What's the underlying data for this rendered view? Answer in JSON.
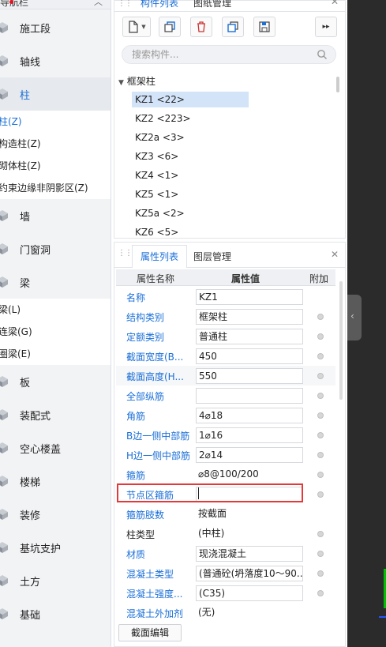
{
  "nav": {
    "header_title": "导航栏",
    "categories_top": [
      {
        "label": "施工段",
        "icon": "construction-segment-icon"
      },
      {
        "label": "轴线",
        "icon": "axis-grid-icon"
      },
      {
        "label": "柱",
        "icon": "column-icon",
        "selected": true
      }
    ],
    "column_subitems": [
      "柱(Z)",
      "构造柱(Z)",
      "砌体柱(Z)",
      "约束边缘非阴影区(Z)"
    ],
    "categories_mid": [
      {
        "label": "墙",
        "icon": "wall-icon"
      },
      {
        "label": "门窗洞",
        "icon": "door-window-icon"
      },
      {
        "label": "梁",
        "icon": "beam-icon"
      }
    ],
    "beam_subitems": [
      "梁(L)",
      "连梁(G)",
      "圈梁(E)"
    ],
    "categories_bottom": [
      {
        "label": "板",
        "icon": "slab-icon"
      },
      {
        "label": "装配式",
        "icon": "prefab-icon"
      },
      {
        "label": "空心楼盖",
        "icon": "hollow-floor-icon"
      },
      {
        "label": "楼梯",
        "icon": "stair-icon"
      },
      {
        "label": "装修",
        "icon": "decoration-icon"
      },
      {
        "label": "基坑支护",
        "icon": "pit-support-icon"
      },
      {
        "label": "土方",
        "icon": "earthwork-icon"
      },
      {
        "label": "基础",
        "icon": "foundation-icon"
      }
    ]
  },
  "component_panel": {
    "tab_list": "构件列表",
    "tab_drawing": "图纸管理",
    "search_placeholder": "搜索构件...",
    "tree_root": "框架柱",
    "items": [
      "KZ1 <22>",
      "KZ2 <223>",
      "KZ2a <3>",
      "KZ3 <6>",
      "KZ4 <1>",
      "KZ5 <1>",
      "KZ5a <2>",
      "KZ6 <5>"
    ]
  },
  "property_panel": {
    "tab_props": "属性列表",
    "tab_layers": "图层管理",
    "col_name": "属性名称",
    "col_value": "属性值",
    "col_extra": "附加",
    "rows": [
      {
        "name": "名称",
        "value": "KZ1",
        "blue": true,
        "boxed": true,
        "check": false
      },
      {
        "name": "结构类别",
        "value": "框架柱",
        "blue": true,
        "boxed": true,
        "check": true
      },
      {
        "name": "定额类别",
        "value": "普通柱",
        "blue": true,
        "boxed": true,
        "check": true
      },
      {
        "name": "截面宽度(B...",
        "value": "450",
        "blue": true,
        "boxed": true,
        "check": true
      },
      {
        "name": "截面高度(H...",
        "value": "550",
        "blue": true,
        "boxed": true,
        "check": true
      },
      {
        "name": "全部纵筋",
        "value": "",
        "blue": true,
        "boxed": true,
        "check": true
      },
      {
        "name": "角筋",
        "value": "4⌀18",
        "blue": true,
        "boxed": true,
        "check": true
      },
      {
        "name": "B边一侧中部筋",
        "value": "1⌀16",
        "blue": true,
        "boxed": true,
        "check": true
      },
      {
        "name": "H边一侧中部筋",
        "value": "2⌀14",
        "blue": true,
        "boxed": true,
        "check": true
      },
      {
        "name": "箍筋",
        "value": "⌀8@100/200",
        "blue": true,
        "boxed": false,
        "check": true
      },
      {
        "name": "节点区箍筋",
        "value": "",
        "blue": true,
        "boxed": true,
        "check": true
      },
      {
        "name": "箍筋肢数",
        "value": "按截面",
        "blue": true,
        "boxed": false,
        "check": false
      },
      {
        "name": "柱类型",
        "value": "(中柱)",
        "blue": false,
        "boxed": false,
        "check": true
      },
      {
        "name": "材质",
        "value": "现浇混凝土",
        "blue": true,
        "boxed": true,
        "check": true
      },
      {
        "name": "混凝土类型",
        "value": "(普通砼(坍落度10～90...",
        "blue": true,
        "boxed": true,
        "check": true
      },
      {
        "name": "混凝土强度...",
        "value": "(C35)",
        "blue": true,
        "boxed": true,
        "check": true
      },
      {
        "name": "混凝土外加剂",
        "value": "(无)",
        "blue": true,
        "boxed": false,
        "check": false
      }
    ],
    "section_edit_button": "截面编辑"
  }
}
